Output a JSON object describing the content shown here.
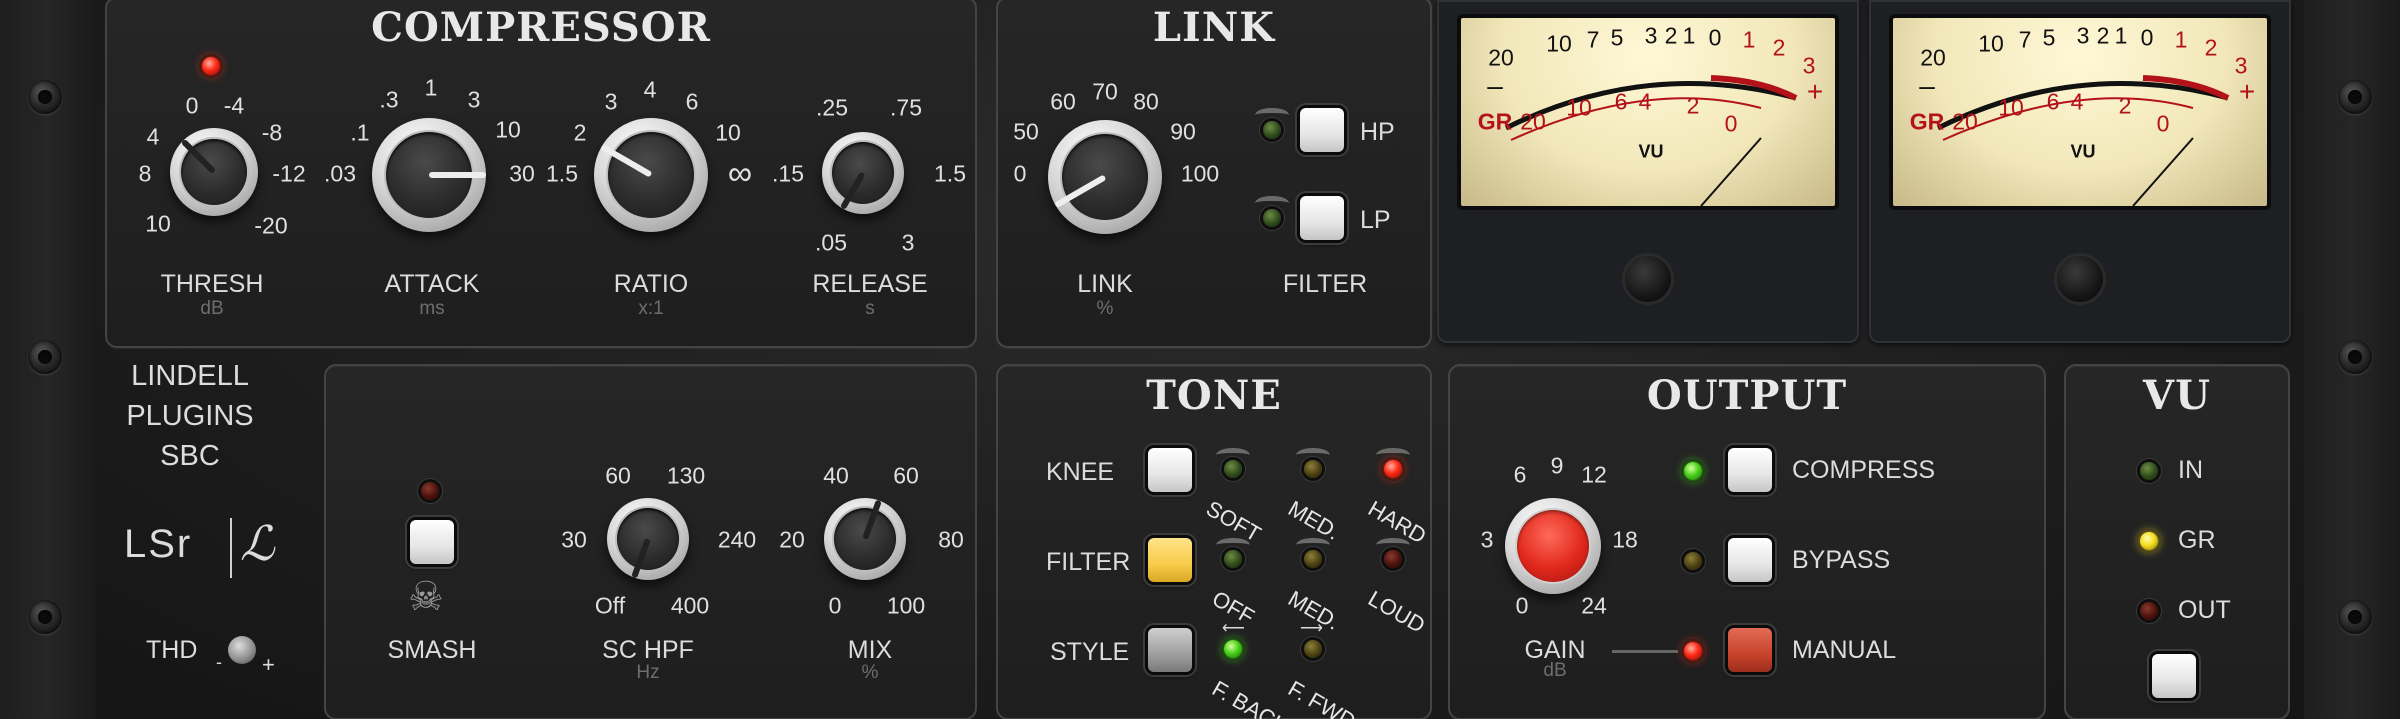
{
  "compressor": {
    "title": "COMPRESSOR",
    "thresh": {
      "label": "THRESH",
      "unit": "dB",
      "ticks": [
        "0",
        "-4",
        "-8",
        "-12",
        "-20",
        "10",
        "8",
        "4"
      ]
    },
    "attack": {
      "label": "ATTACK",
      "unit": "ms",
      "ticks": [
        ".03",
        ".1",
        ".3",
        "1",
        "3",
        "10",
        "30"
      ]
    },
    "ratio": {
      "label": "RATIO",
      "unit": "x:1",
      "ticks": [
        "1.5",
        "2",
        "3",
        "4",
        "6",
        "10",
        "∞"
      ]
    },
    "release": {
      "label": "RELEASE",
      "unit": "s",
      "ticks": [
        ".15",
        ".25",
        ".75",
        "1.5",
        ".05",
        "3"
      ]
    }
  },
  "link": {
    "title": "LINK",
    "knob": {
      "label": "LINK",
      "unit": "%",
      "ticks": [
        "0",
        "50",
        "60",
        "70",
        "80",
        "90",
        "100"
      ]
    },
    "hp_label": "HP",
    "lp_label": "LP",
    "filter_label": "FILTER"
  },
  "meters": {
    "scale_top": [
      "20",
      "10",
      "7",
      "5",
      "3",
      "2",
      "1",
      "0",
      "1",
      "2",
      "3"
    ],
    "scale_bottom": [
      "20",
      "10",
      "6",
      "4",
      "2",
      "0"
    ],
    "gr_label": "GR",
    "vu_label": "VU",
    "minus": "–",
    "plus": "+"
  },
  "brand": {
    "line1": "LINDELL",
    "line2": "PLUGINS",
    "line3": "SBC",
    "logo_lsr": "LSr",
    "logo_l": "ℒ",
    "thd_label": "THD",
    "thd_minus": "-",
    "thd_plus": "+"
  },
  "sidechain": {
    "smash_label": "SMASH",
    "schpf": {
      "label": "SC HPF",
      "unit": "Hz",
      "ticks": [
        "30",
        "60",
        "130",
        "240",
        "Off",
        "400"
      ]
    },
    "mix": {
      "label": "MIX",
      "unit": "%",
      "ticks": [
        "20",
        "40",
        "60",
        "80",
        "0",
        "100"
      ]
    }
  },
  "tone": {
    "title": "TONE",
    "knee_label": "KNEE",
    "filter_label": "FILTER",
    "style_label": "STYLE",
    "knee_opts": [
      "SOFT",
      "MED.",
      "HARD"
    ],
    "filter_opts": [
      "OFF",
      "MED.",
      "LOUD"
    ],
    "style_opts": [
      "F. BACK",
      "F. FWD"
    ]
  },
  "output": {
    "title": "OUTPUT",
    "gain": {
      "label": "GAIN",
      "unit": "dB",
      "ticks": [
        "6",
        "9",
        "12",
        "3",
        "18",
        "0",
        "24"
      ]
    },
    "compress_label": "COMPRESS",
    "bypass_label": "BYPASS",
    "manual_label": "MANUAL"
  },
  "vu": {
    "title": "VU",
    "in_label": "IN",
    "gr_label": "GR",
    "out_label": "OUT"
  }
}
